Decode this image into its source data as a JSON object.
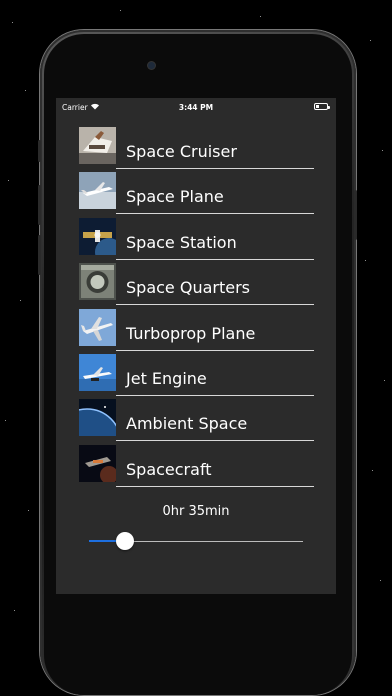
{
  "status_bar": {
    "carrier": "Carrier",
    "time": "3:44 PM"
  },
  "sounds": [
    {
      "label": "Space Cruiser",
      "thumbnail": "space-cruiser-thumbnail"
    },
    {
      "label": "Space Plane",
      "thumbnail": "space-plane-thumbnail"
    },
    {
      "label": "Space Station",
      "thumbnail": "space-station-thumbnail"
    },
    {
      "label": "Space Quarters",
      "thumbnail": "space-quarters-thumbnail"
    },
    {
      "label": "Turboprop Plane",
      "thumbnail": "turboprop-plane-thumbnail"
    },
    {
      "label": "Jet Engine",
      "thumbnail": "jet-engine-thumbnail"
    },
    {
      "label": "Ambient Space",
      "thumbnail": "ambient-space-thumbnail"
    },
    {
      "label": "Spacecraft",
      "thumbnail": "spacecraft-thumbnail"
    }
  ],
  "timer": {
    "label": "0hr 35min",
    "slider_fraction": 0.17
  },
  "colors": {
    "screen_background": "#2b2b2b",
    "slider_fill": "#1d6fe0",
    "text": "#ffffff"
  }
}
